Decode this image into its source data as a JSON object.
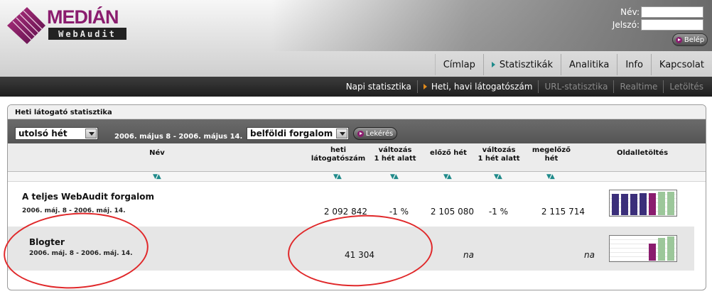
{
  "header": {
    "logo_top": "MEDIÁN",
    "logo_bottom": "WebAudit",
    "login": {
      "name_label": "Név:",
      "password_label": "Jelszó:",
      "name_value": "",
      "password_value": "",
      "submit_label": "Belép"
    }
  },
  "main_nav": [
    {
      "label": "Címlap"
    },
    {
      "label": "Statisztikák"
    },
    {
      "label": "Analitika"
    },
    {
      "label": "Info"
    },
    {
      "label": "Kapcsolat"
    }
  ],
  "sub_nav": [
    {
      "label": "Napi statisztika"
    },
    {
      "label": "Heti, havi látogatószám"
    },
    {
      "label": "URL-statisztika"
    },
    {
      "label": "Realtime"
    },
    {
      "label": "Letöltés"
    }
  ],
  "panel": {
    "title": "Heti látogató statisztika",
    "period_select": "utolsó hét",
    "date_range": "2006. május 8 - 2006. május 14.",
    "traffic_select": "belföldi forgalom",
    "query_button": "Lekérés",
    "columns": {
      "name": "Név",
      "weekly_line1": "heti",
      "weekly_line2": "látogatószám",
      "change1_line1": "változás",
      "change1_line2": "1 hét alatt",
      "prev_week": "előző hét",
      "change2_line1": "változás",
      "change2_line2": "1 hét alatt",
      "before_line1": "megelőző",
      "before_line2": "hét",
      "download": "Oldalletöltés"
    },
    "sort_icon": "▼▲",
    "rows": [
      {
        "name": "A teljes WebAudit forgalom",
        "date": "2006. máj. 8 - 2006. máj. 14.",
        "weekly": "2 092 842",
        "change1": "-1 %",
        "prev_week": "2 105 080",
        "change2": "-1 %",
        "before": "2 115 714"
      },
      {
        "name": "Blogter",
        "date": "2006. máj. 8 - 2006. máj. 14.",
        "weekly": "41 304",
        "change1": "",
        "prev_week": "na",
        "change2": "",
        "before": "na"
      }
    ]
  },
  "colors": {
    "accent_purple": "#8a1c6e",
    "bar_blue": "#3b2f7a",
    "bar_green": "#9cc79a",
    "annotation_red": "#e0282a"
  }
}
